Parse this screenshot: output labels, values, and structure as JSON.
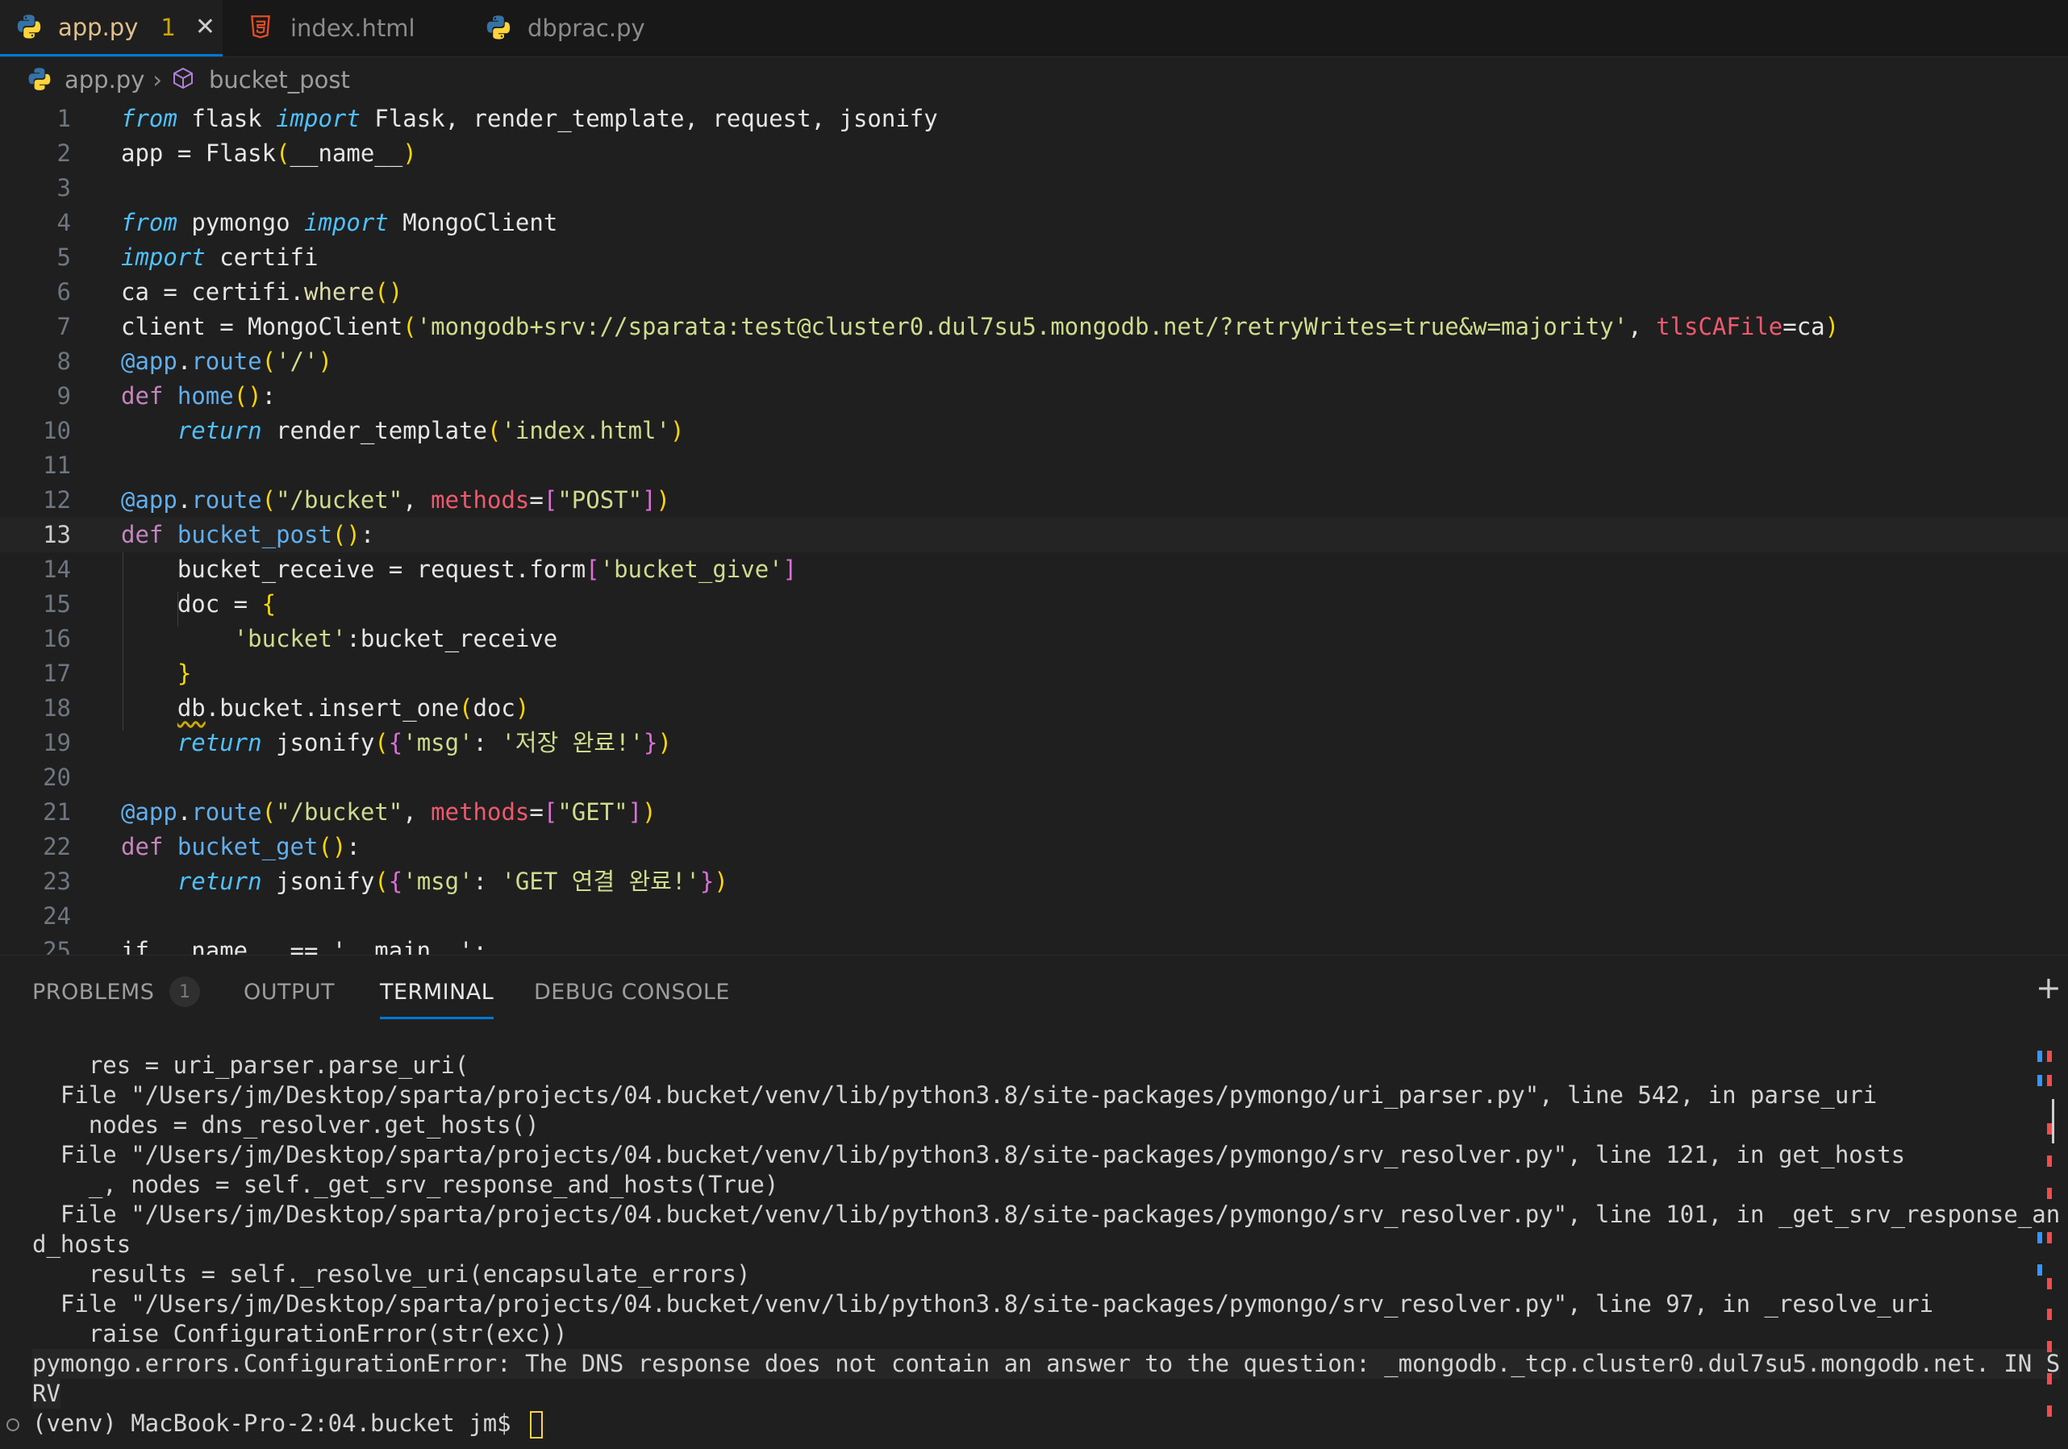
{
  "tabs": [
    {
      "label": "app.py",
      "badge": "1",
      "icon": "python-icon"
    },
    {
      "label": "index.html",
      "icon": "html5-icon"
    },
    {
      "label": "dbprac.py",
      "icon": "python-icon"
    }
  ],
  "breadcrumb": {
    "file": "app.py",
    "symbol": "bucket_post"
  },
  "editor": {
    "line_numbers": [
      "1",
      "2",
      "3",
      "4",
      "5",
      "6",
      "7",
      "8",
      "9",
      "10",
      "11",
      "12",
      "13",
      "14",
      "15",
      "16",
      "17",
      "18",
      "19",
      "20",
      "21",
      "22",
      "23",
      "24",
      "25"
    ],
    "current_line": "13",
    "code": {
      "from": "from",
      "import": "import",
      "flask": "flask",
      "flask_imports": "Flask, render_template, request, jsonify",
      "app_eq": "app = ",
      "Flask": "Flask",
      "dunder_name": "__name__",
      "pymongo": "pymongo",
      "MongoClient": "MongoClient",
      "certifi": "certifi",
      "ca_eq": "ca = ",
      "certifi_where": "certifi.",
      "where": "where",
      "client_eq": "client = ",
      "uri": "'mongodb+srv://sparata:test@cluster0.dul7su5.mongodb.net/?retryWrites=true&w=majority'",
      "tlsCAFile": "tlsCAFile",
      "ca": "ca",
      "at_app": "@app",
      "route": "route",
      "slash": "'/'",
      "def": "def",
      "home": "home",
      "return": "return",
      "render_template": "render_template",
      "index_html": "'index.html'",
      "bucket_path": "\"/bucket\"",
      "methods": "methods",
      "POST": "\"POST\"",
      "bucket_post": "bucket_post",
      "bucket_receive_eq": "bucket_receive = request.form",
      "bucket_give": "'bucket_give'",
      "doc_eq": "doc = ",
      "bucket_key": "'bucket'",
      "bucket_val": ":bucket_receive",
      "db": "db",
      "insert_rest": ".bucket.insert_one",
      "doc": "doc",
      "jsonify": "jsonify",
      "msg_key": "'msg'",
      "msg_saved": "'저장 완료!'",
      "GET": "\"GET\"",
      "bucket_get": "bucket_get",
      "msg_get": "'GET 연결 완료!'",
      "line25": "if __name__ == '__main__':"
    }
  },
  "panel": {
    "tabs": [
      "PROBLEMS",
      "OUTPUT",
      "TERMINAL",
      "DEBUG CONSOLE"
    ],
    "problems_count": "1",
    "terminal_lines": [
      "    res = uri_parser.parse_uri(",
      "  File \"/Users/jm/Desktop/sparta/projects/04.bucket/venv/lib/python3.8/site-packages/pymongo/uri_parser.py\", line 542, in parse_uri",
      "    nodes = dns_resolver.get_hosts()",
      "  File \"/Users/jm/Desktop/sparta/projects/04.bucket/venv/lib/python3.8/site-packages/pymongo/srv_resolver.py\", line 121, in get_hosts",
      "    _, nodes = self._get_srv_response_and_hosts(True)",
      "  File \"/Users/jm/Desktop/sparta/projects/04.bucket/venv/lib/python3.8/site-packages/pymongo/srv_resolver.py\", line 101, in _get_srv_response_an",
      "d_hosts",
      "    results = self._resolve_uri(encapsulate_errors)",
      "  File \"/Users/jm/Desktop/sparta/projects/04.bucket/venv/lib/python3.8/site-packages/pymongo/srv_resolver.py\", line 97, in _resolve_uri",
      "    raise ConfigurationError(str(exc))",
      "pymongo.errors.ConfigurationError: The DNS response does not contain an answer to the question: _mongodb._tcp.cluster0.dul7su5.mongodb.net. IN S",
      "RV",
      "(venv) MacBook-Pro-2:04.bucket jm$ "
    ]
  }
}
